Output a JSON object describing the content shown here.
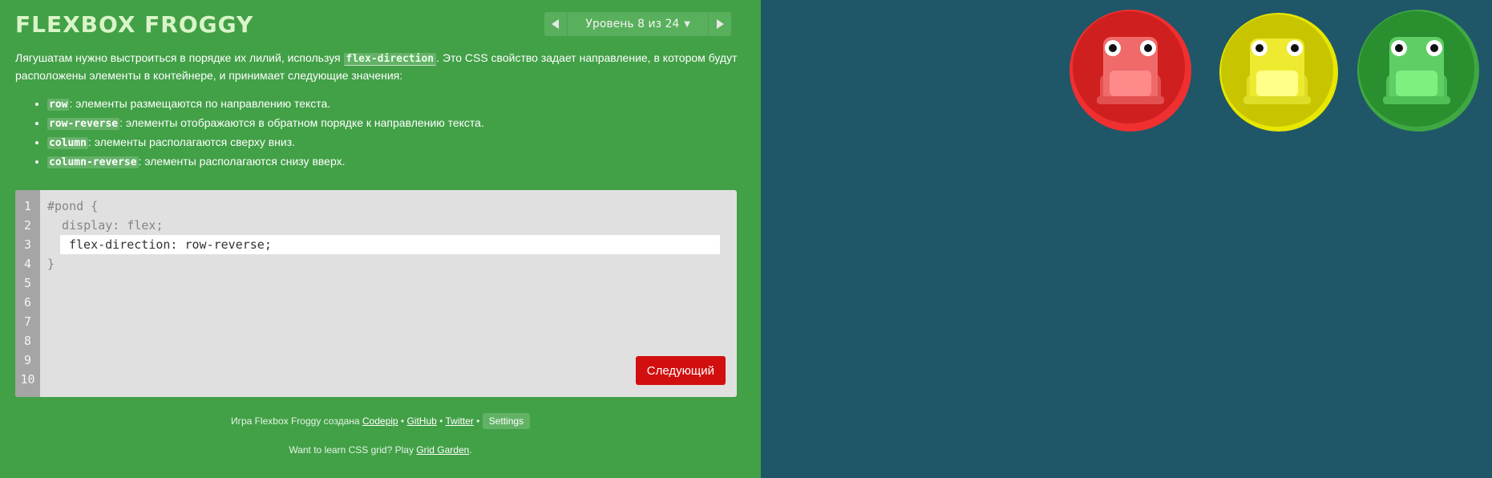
{
  "header": {
    "logo": "FLEXBOX FROGGY",
    "level_label": "Уровень 8 из 24"
  },
  "instructions": {
    "intro_before": "Лягушатам нужно выстроиться в порядке их лилий, используя ",
    "intro_code": "flex-direction",
    "intro_after": ". Это CSS свойство задает направление, в котором будут расположены элементы в контейнере, и принимает следующие значения:",
    "values": [
      {
        "code": "row",
        "text": ": элементы размещаются по направлению текста."
      },
      {
        "code": "row-reverse",
        "text": ": элементы отображаются в обратном порядке к направлению текста."
      },
      {
        "code": "column",
        "text": ": элементы располагаются сверху вниз."
      },
      {
        "code": "column-reverse",
        "text": ": элементы располагаются снизу вверх."
      }
    ]
  },
  "editor": {
    "line_numbers": [
      "1",
      "2",
      "3",
      "4",
      "5",
      "6",
      "7",
      "8",
      "9",
      "10"
    ],
    "line1": "#pond {",
    "line2": "  display: flex;",
    "input_value": "flex-direction: row-reverse;",
    "line4": "}",
    "next_label": "Следующий"
  },
  "footer": {
    "credit_prefix": "Игра Flexbox Froggy создана ",
    "codepip": "Codepip",
    "github": "GitHub",
    "twitter": "Twitter",
    "bullet": " • ",
    "settings": "Settings",
    "learn_prefix": "Want to learn CSS grid? Play ",
    "grid_garden": "Grid Garden",
    "learn_suffix": "."
  },
  "pond": {
    "frogs": [
      {
        "color": "red",
        "pad": "#d42424",
        "body": "#f06a6a",
        "belly": "#ff8a8a"
      },
      {
        "color": "yellow",
        "pad": "#c9c400",
        "body": "#eeea30",
        "belly": "#ffff8a"
      },
      {
        "color": "green",
        "pad": "#2a8f2f",
        "body": "#5fcf65",
        "belly": "#7ef07f"
      }
    ]
  }
}
